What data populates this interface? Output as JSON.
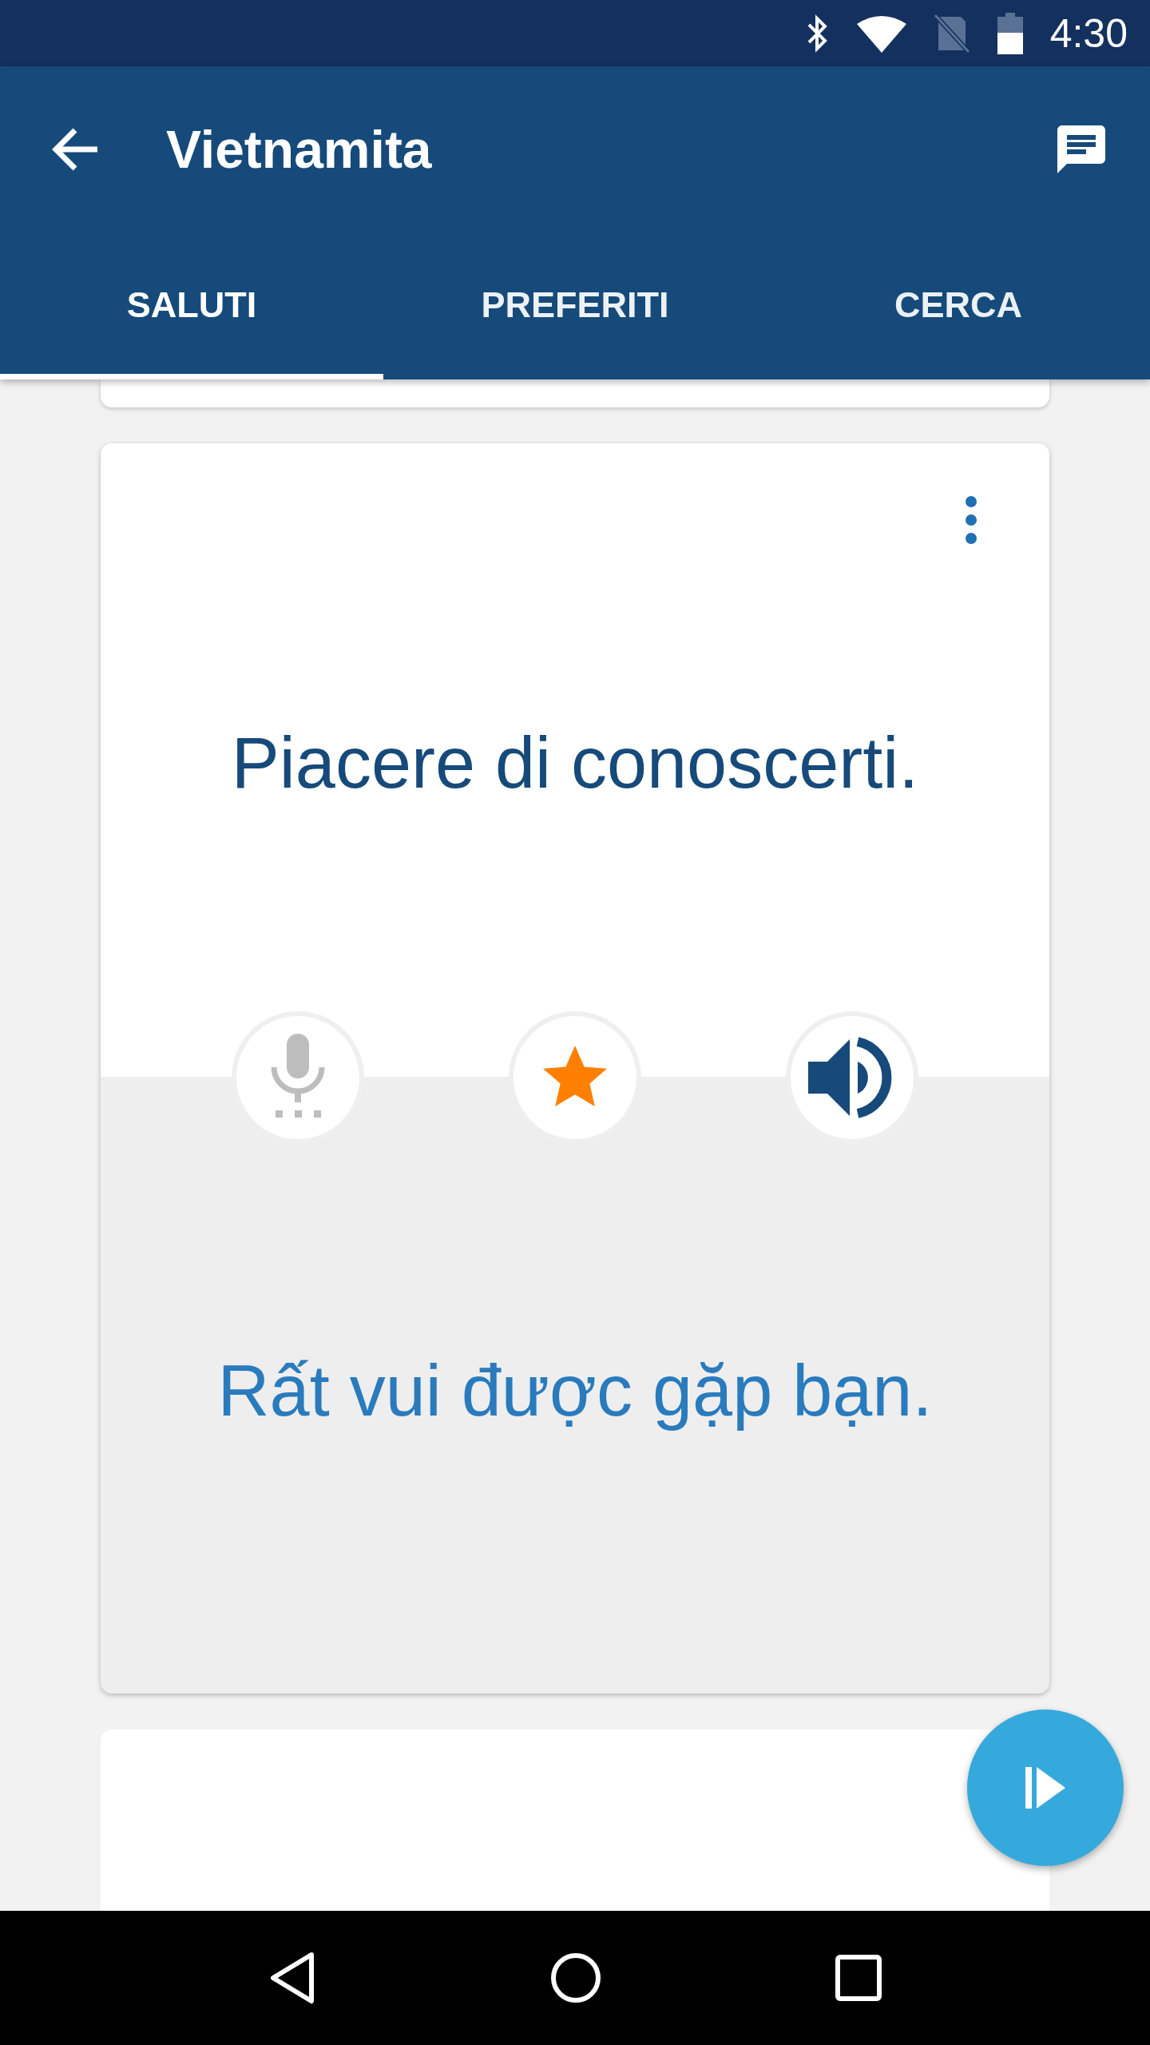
{
  "status_bar": {
    "time": "4:30"
  },
  "app_bar": {
    "title": "Vietnamita"
  },
  "tabs": [
    {
      "label": "SALUTI",
      "selected": true
    },
    {
      "label": "PREFERITI",
      "selected": false
    },
    {
      "label": "CERCA",
      "selected": false
    }
  ],
  "card": {
    "phrase": "Piacere di conoscerti.",
    "translation": "Rất vui được gặp bạn.",
    "favorite": true,
    "record_disabled": true
  }
}
